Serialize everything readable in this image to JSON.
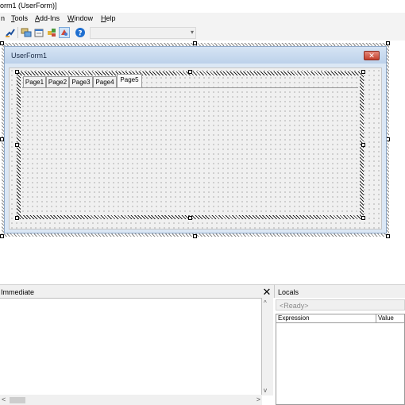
{
  "window": {
    "title": "orm1 (UserForm)]"
  },
  "menu": [
    {
      "key": "",
      "rest": "n"
    },
    {
      "key": "T",
      "rest": "ools"
    },
    {
      "key": "A",
      "rest": "dd-Ins"
    },
    {
      "key": "W",
      "rest": "indow"
    },
    {
      "key": "H",
      "rest": "elp"
    }
  ],
  "toolbar": {
    "icons": [
      "design-mode-icon",
      "project-explorer-icon",
      "properties-window-icon",
      "object-browser-icon",
      "toolbox-icon",
      "help-icon"
    ],
    "colors": {
      "help": "#1f6fd0",
      "toolbox_bg": "#cfe3f7"
    }
  },
  "userform": {
    "title": "UserForm1",
    "close_label": "✕"
  },
  "multipage": {
    "tabs": [
      "Page1",
      "Page2",
      "Page3",
      "Page4",
      "Page5"
    ],
    "active_tab": "Page5"
  },
  "immediate": {
    "title": "Immediate",
    "close_label": "✕"
  },
  "locals": {
    "title": "Locals",
    "context": "<Ready>",
    "columns": {
      "expression": "Expression",
      "value": "Value"
    }
  },
  "colors": {
    "form_caption": "#bcd1ea",
    "form_close": "#c4402d",
    "grid_dots": "#6b6b6b"
  }
}
